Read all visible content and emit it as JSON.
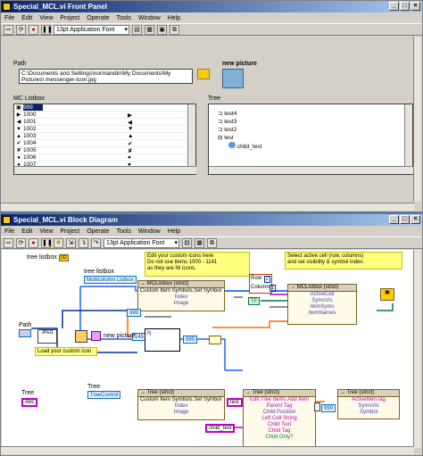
{
  "front_panel": {
    "title": "Special_MCL.vi Front Panel",
    "menu": [
      "File",
      "Edit",
      "View",
      "Project",
      "Operate",
      "Tools",
      "Window",
      "Help"
    ],
    "font": "13pt Application Font",
    "path_label": "Path",
    "path_value": "C:\\Documents and Settings\\normandin\\My Documents\\My Pictures\\ messenger-icon.jpg",
    "new_picture_label": "new picture",
    "listbox_label": "MC Listbox",
    "listbox_rows": [
      {
        "sym": "▣",
        "num": "999",
        "sym2": "",
        "sel": true
      },
      {
        "sym": "▶",
        "num": "1000",
        "sym2": "▶"
      },
      {
        "sym": "◀",
        "num": "1001",
        "sym2": "◀"
      },
      {
        "sym": "▼",
        "num": "1002",
        "sym2": "▼"
      },
      {
        "sym": "▲",
        "num": "1003",
        "sym2": "▲"
      },
      {
        "sym": "✔",
        "num": "1004",
        "sym2": "✔"
      },
      {
        "sym": "✘",
        "num": "1005",
        "sym2": "✘"
      },
      {
        "sym": "●",
        "num": "1006",
        "sym2": "●"
      },
      {
        "sym": "●",
        "num": "1007",
        "sym2": "●"
      }
    ],
    "tree_label": "Tree",
    "tree_items": [
      "test4",
      "test3",
      "test2",
      "test",
      "child_test"
    ]
  },
  "block_diagram": {
    "title": "Special_MCL.vi Block Diagram",
    "menu": [
      "File",
      "Edit",
      "View",
      "Project",
      "Operate",
      "Tools",
      "Window",
      "Help"
    ],
    "font": "13pt Application Font",
    "tree_listbox_terminal": "tree listbox",
    "tree_listbox_ref": "Multicolumn Listbox",
    "tree_listbox_const": "TRUE",
    "note_custom_icons": "Edit your custom icons here\nDo not use items 1000 - 1141\nas they are NI icons.",
    "note_select_cell": "Select active cell (row, columns)\nand set visibility & symbol index.",
    "note_load_icon": "Load your custom icon",
    "mclistbox_node1_title": "MCListbox (strict)",
    "mclistbox_node1_rows": [
      "Custom Item Symbols.Set Symbol",
      "Index",
      "Image"
    ],
    "mclistbox_node2_title": "MCListbox (strict)",
    "mclistbox_node2_rows": [
      "ActiveCell",
      "SymsVis",
      "ItemSyms",
      "ItemNames"
    ],
    "row_label": "Row",
    "column_label": "Column",
    "row_val": "2",
    "column_val": "1",
    "tf_const": "TF",
    "const_999": "999",
    "const_145": "145",
    "const_999b": "999",
    "path_term": "Path",
    "new_picture_term": "new picture",
    "tree_term": "Tree",
    "tree_ref": "TreeControl",
    "tree_node1_title": "Tree (strict)",
    "tree_node1_rows": [
      "Custom Item Symbols.Set Symbol",
      "Index",
      "Image"
    ],
    "tree_node2_title": "Tree (strict)",
    "tree_node2_rows": [
      "Edit Tree Items.Add Item",
      "Parent Tag",
      "Child Position",
      "Left Cell String",
      "Child Text",
      "Child Tag",
      "Child Only?"
    ],
    "tree_node3_title": "Tree (strict)",
    "tree_node3_rows": [
      "ActiveItemTag",
      "SymsVis",
      "Symbol"
    ],
    "test_const": "test",
    "child_test_const": "child_test",
    "const_999c": "999"
  }
}
